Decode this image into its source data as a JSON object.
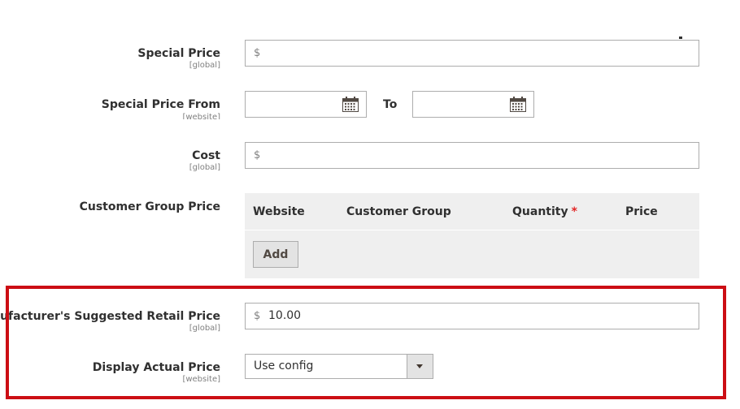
{
  "fields": {
    "special_price": {
      "label": "Special Price",
      "scope": "[global]",
      "prefix": "$",
      "value": ""
    },
    "special_price_from": {
      "label": "Special Price From",
      "scope": "[website]",
      "to_label": "To",
      "from_value": "",
      "to_value": ""
    },
    "cost": {
      "label": "Cost",
      "scope": "[global]",
      "prefix": "$",
      "value": ""
    },
    "customer_group_price": {
      "label": "Customer Group Price",
      "columns": {
        "website": "Website",
        "customer_group": "Customer Group",
        "quantity": "Quantity",
        "required_mark": "*",
        "price": "Price"
      },
      "add_button": "Add"
    },
    "msrp": {
      "label": "Manufacturer's Suggested Retail Price",
      "scope": "[global]",
      "prefix": "$",
      "value": "10.00"
    },
    "display_actual_price": {
      "label": "Display Actual Price",
      "scope": "[website]",
      "selected": "Use config"
    }
  },
  "colors": {
    "highlight_border": "#cc0e14",
    "required": "#e22626",
    "grid_bg": "#efefef"
  },
  "icons": {
    "date_picker": "calendar-icon",
    "select_arrow": "chevron-down-icon"
  }
}
